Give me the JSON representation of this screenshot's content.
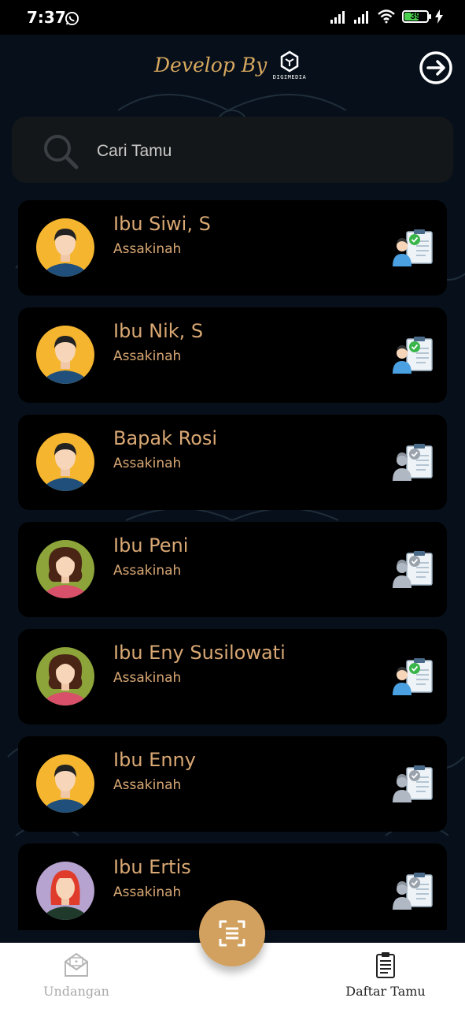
{
  "status_bar": {
    "time": "7:37",
    "battery": "39",
    "icons": [
      "whatsapp-icon",
      "signal-icon",
      "signal-icon",
      "wifi-icon",
      "battery-icon",
      "charging-icon"
    ]
  },
  "header": {
    "develop_by": "Develop By",
    "brand_name": "DIGIMEDIA",
    "logout_icon": "logout-icon"
  },
  "search": {
    "placeholder": "Cari Tamu"
  },
  "guests": [
    {
      "name": "Ibu Siwi, S",
      "group": "Assakinah",
      "avatar": "male",
      "checked": true
    },
    {
      "name": "Ibu Nik, S",
      "group": "Assakinah",
      "avatar": "male",
      "checked": true
    },
    {
      "name": "Bapak Rosi",
      "group": "Assakinah",
      "avatar": "male",
      "checked": false
    },
    {
      "name": "Ibu Peni",
      "group": "Assakinah",
      "avatar": "female-curly",
      "checked": false
    },
    {
      "name": "Ibu Eny Susilowati",
      "group": "Assakinah",
      "avatar": "female-curly",
      "checked": true
    },
    {
      "name": "Ibu Enny",
      "group": "Assakinah",
      "avatar": "male",
      "checked": false
    },
    {
      "name": "Ibu Ertis",
      "group": "Assakinah",
      "avatar": "female-red",
      "checked": false
    }
  ],
  "bottom_nav": {
    "undangan_label": "Undangan",
    "daftar_tamu_label": "Daftar Tamu",
    "scan_icon": "scan-icon"
  },
  "colors": {
    "accent": "#d3a15f",
    "name_text": "#d9a874",
    "background": "#07101a",
    "card": "#000000"
  }
}
